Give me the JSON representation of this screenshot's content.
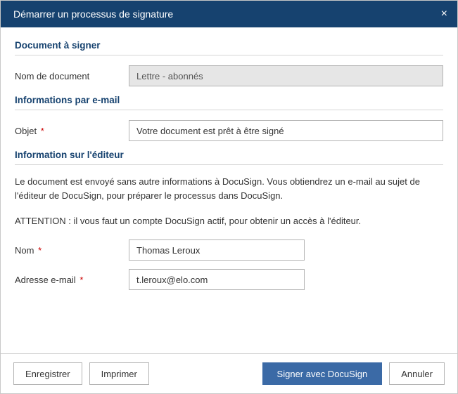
{
  "title": "Démarrer un processus de signature",
  "sections": {
    "doc": {
      "header": "Document à signer",
      "docname_label": "Nom de document",
      "docname_value": "Lettre - abonnés"
    },
    "email": {
      "header": "Informations par e-mail",
      "subject_label": "Objet",
      "subject_value": "Votre document est prêt à être signé"
    },
    "editor": {
      "header": "Information sur l'éditeur",
      "info1": "Le document est envoyé sans autre informations à DocuSign. Vous obtiendrez un e-mail au sujet de l'éditeur de DocuSign, pour préparer le processus dans DocuSign.",
      "info2": "ATTENTION : il vous faut un compte DocuSign actif, pour obtenir un accès à l'éditeur.",
      "name_label": "Nom",
      "name_value": "Thomas Leroux",
      "email_label": "Adresse e-mail",
      "email_value": "t.leroux@elo.com"
    }
  },
  "required_mark": "*",
  "buttons": {
    "save": "Enregistrer",
    "print": "Imprimer",
    "sign": "Signer avec DocuSign",
    "cancel": "Annuler"
  }
}
